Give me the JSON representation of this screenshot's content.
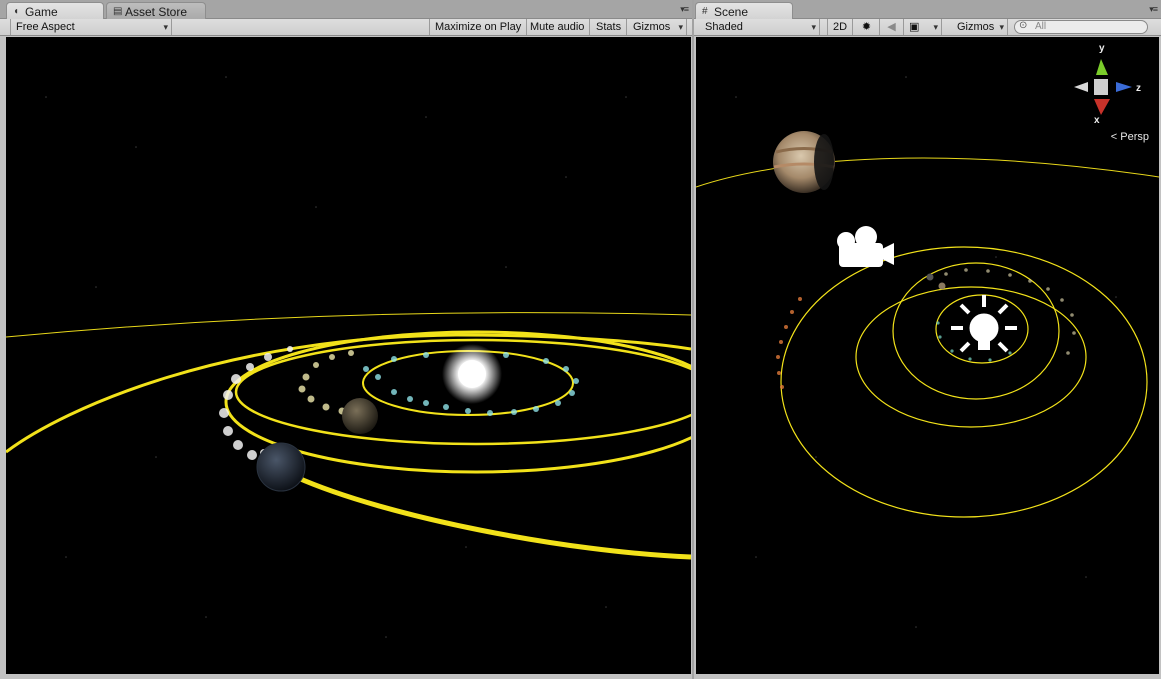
{
  "game": {
    "tab_label": "Game",
    "second_tab_label": "Asset Store",
    "tab_menu_glyph": "▾≡",
    "aspect_label": "Free Aspect",
    "buttons": [
      "Maximize on Play",
      "Mute audio",
      "Stats",
      "Gizmos"
    ]
  },
  "scene": {
    "tab_label": "Scene",
    "tab_menu_glyph": "▾≡",
    "shading_label": "Shaded",
    "mode_2d_label": "2D",
    "gizmos_label": "Gizmos",
    "search_placeholder": "All",
    "search_icon_glyph": "⊙",
    "gizmo_y_label": "y",
    "gizmo_z_label": "z",
    "gizmo_x_label": "x",
    "projection_label": "Persp",
    "projection_glyph": "<"
  },
  "icons": {
    "game_tab_icon": "pacman-icon",
    "asset_store_icon": "store-icon",
    "scene_tab_icon": "grid-icon",
    "lighting_icon": "sun-icon",
    "audio_icon": "speaker-icon",
    "effects_icon": "image-icon",
    "camera_gizmo": "camera-icon",
    "light_gizmo": "light-bulb-icon",
    "jupiter": "planet-icon"
  },
  "colors": {
    "orbit_yellow": "#f2e21a",
    "space_black": "#000000",
    "gizmo_y_green": "#7acc2a",
    "gizmo_z_blue": "#3b6cd8",
    "gizmo_x_red": "#c8322a"
  }
}
